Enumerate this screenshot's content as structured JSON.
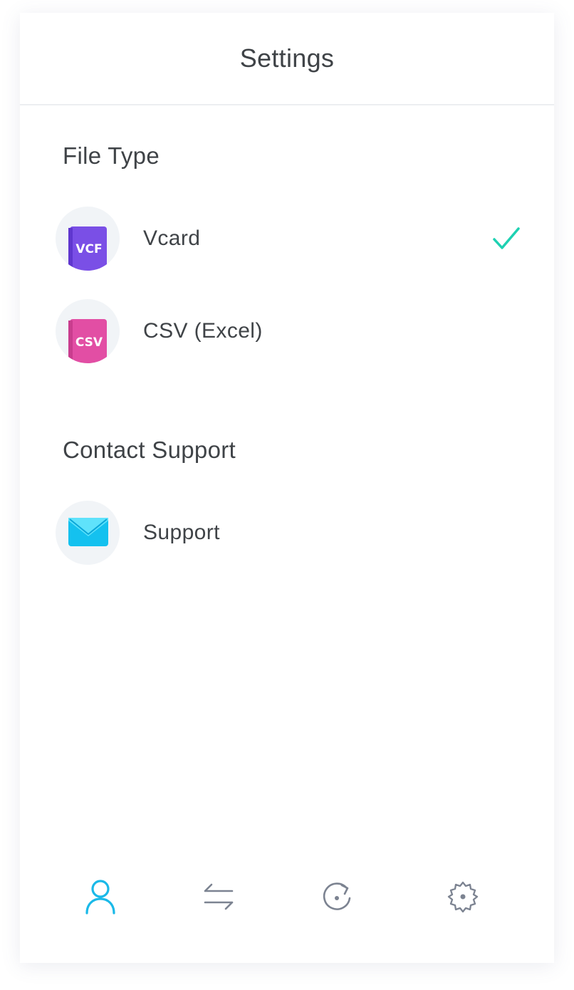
{
  "header": {
    "title": "Settings"
  },
  "sections": {
    "file_type": {
      "title": "File Type",
      "items": [
        {
          "label": "Vcard",
          "icon": "vcf-file-icon",
          "icon_text": "VCF",
          "icon_color": "#7a4fe6",
          "selected": true
        },
        {
          "label": "CSV (Excel)",
          "icon": "csv-file-icon",
          "icon_text": "CSV",
          "icon_color": "#e24ea4",
          "selected": false
        }
      ]
    },
    "contact_support": {
      "title": "Contact Support",
      "items": [
        {
          "label": "Support",
          "icon": "mail-icon",
          "icon_color": "#1ec8f5"
        }
      ]
    }
  },
  "tabbar": {
    "items": [
      {
        "icon": "user-icon",
        "active": true
      },
      {
        "icon": "transfer-arrows-icon",
        "active": false
      },
      {
        "icon": "refresh-icon",
        "active": false
      },
      {
        "icon": "gear-icon",
        "active": false
      }
    ]
  },
  "colors": {
    "check": "#1ed1b2",
    "tab_active": "#1ab9e8",
    "tab_inactive": "#7c8391"
  }
}
